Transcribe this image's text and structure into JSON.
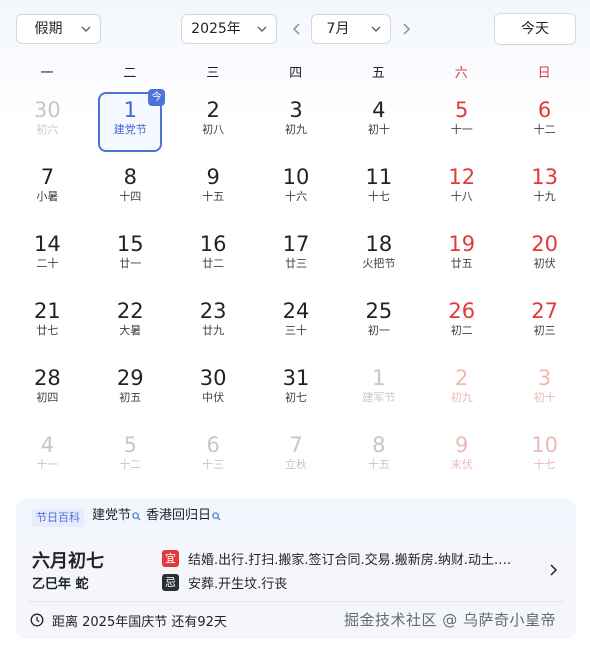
{
  "header": {
    "holiday_select": "假期",
    "year_select": "2025年",
    "month_select": "7月",
    "today_button": "今天",
    "prev_icon": "chevron-left-icon",
    "next_icon": "chevron-right-icon"
  },
  "weekdays": [
    {
      "label": "一",
      "weekend": false
    },
    {
      "label": "二",
      "weekend": false
    },
    {
      "label": "三",
      "weekend": false
    },
    {
      "label": "四",
      "weekend": false
    },
    {
      "label": "五",
      "weekend": false
    },
    {
      "label": "六",
      "weekend": true
    },
    {
      "label": "日",
      "weekend": true
    }
  ],
  "days": [
    {
      "num": "30",
      "lunar": "初六",
      "other": true
    },
    {
      "num": "1",
      "lunar": "建党节",
      "today": true,
      "badge": "今"
    },
    {
      "num": "2",
      "lunar": "初八"
    },
    {
      "num": "3",
      "lunar": "初九"
    },
    {
      "num": "4",
      "lunar": "初十"
    },
    {
      "num": "5",
      "lunar": "十一",
      "weekend": true
    },
    {
      "num": "6",
      "lunar": "十二",
      "weekend": true
    },
    {
      "num": "7",
      "lunar": "小暑"
    },
    {
      "num": "8",
      "lunar": "十四"
    },
    {
      "num": "9",
      "lunar": "十五"
    },
    {
      "num": "10",
      "lunar": "十六"
    },
    {
      "num": "11",
      "lunar": "十七"
    },
    {
      "num": "12",
      "lunar": "十八",
      "weekend": true
    },
    {
      "num": "13",
      "lunar": "十九",
      "weekend": true
    },
    {
      "num": "14",
      "lunar": "二十"
    },
    {
      "num": "15",
      "lunar": "廿一"
    },
    {
      "num": "16",
      "lunar": "廿二"
    },
    {
      "num": "17",
      "lunar": "廿三"
    },
    {
      "num": "18",
      "lunar": "火把节"
    },
    {
      "num": "19",
      "lunar": "廿五",
      "weekend": true
    },
    {
      "num": "20",
      "lunar": "初伏",
      "weekend": true
    },
    {
      "num": "21",
      "lunar": "廿七"
    },
    {
      "num": "22",
      "lunar": "大暑"
    },
    {
      "num": "23",
      "lunar": "廿九"
    },
    {
      "num": "24",
      "lunar": "三十"
    },
    {
      "num": "25",
      "lunar": "初一"
    },
    {
      "num": "26",
      "lunar": "初二",
      "weekend": true
    },
    {
      "num": "27",
      "lunar": "初三",
      "weekend": true
    },
    {
      "num": "28",
      "lunar": "初四"
    },
    {
      "num": "29",
      "lunar": "初五"
    },
    {
      "num": "30",
      "lunar": "中伏"
    },
    {
      "num": "31",
      "lunar": "初七"
    },
    {
      "num": "1",
      "lunar": "建军节",
      "other": true
    },
    {
      "num": "2",
      "lunar": "初九",
      "other": true,
      "weekend": true
    },
    {
      "num": "3",
      "lunar": "初十",
      "other": true,
      "weekend": true
    },
    {
      "num": "4",
      "lunar": "十一",
      "other": true
    },
    {
      "num": "5",
      "lunar": "十二",
      "other": true
    },
    {
      "num": "6",
      "lunar": "十三",
      "other": true
    },
    {
      "num": "7",
      "lunar": "立秋",
      "other": true
    },
    {
      "num": "8",
      "lunar": "十五",
      "other": true
    },
    {
      "num": "9",
      "lunar": "末伏",
      "other": true,
      "weekend": true
    },
    {
      "num": "10",
      "lunar": "十七",
      "other": true,
      "weekend": true
    }
  ],
  "festivals": {
    "tag": "节日百科",
    "links": [
      "建党节",
      "香港回归日"
    ],
    "link_icon": "search-icon"
  },
  "info": {
    "lunar_date": "六月初七",
    "ganzhi": "乙巳年 蛇",
    "yi_label": "宜",
    "yi_text": "结婚.出行.打扫.搬家.签订合同.交易.搬新房.纳财.动土.…",
    "ji_label": "忌",
    "ji_text": "安葬.开生坟.行丧",
    "countdown": "距离 2025年国庆节 还有92天",
    "watermark": "掘金技术社区 @ 乌萨奇小皇帝"
  },
  "colors": {
    "accent": "#4d72d8",
    "weekend": "#e03a3a",
    "muted": "#c3c7cd"
  }
}
